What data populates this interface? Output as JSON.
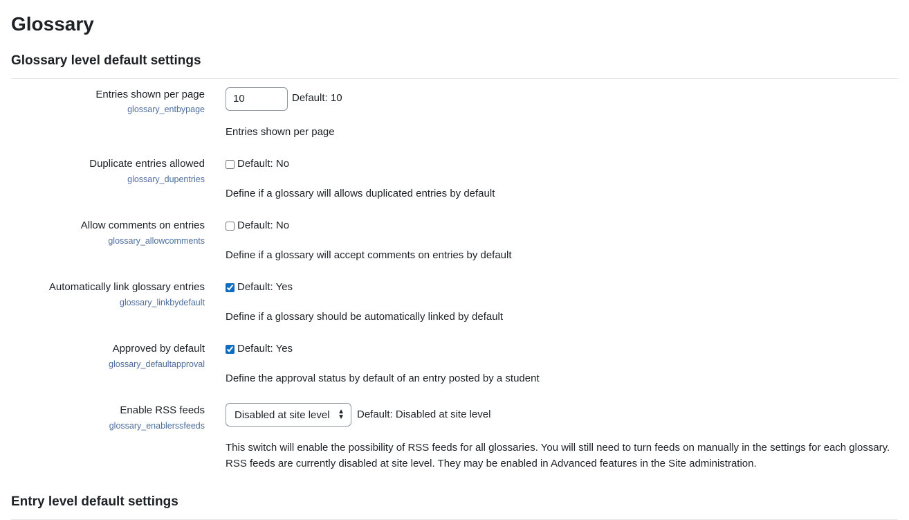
{
  "page": {
    "title": "Glossary",
    "section1_title": "Glossary level default settings",
    "section2_title": "Entry level default settings"
  },
  "settings": {
    "entbypage": {
      "label": "Entries shown per page",
      "key": "glossary_entbypage",
      "value": "10",
      "default_text": "Default: 10",
      "description": "Entries shown per page"
    },
    "dupentries": {
      "label": "Duplicate entries allowed",
      "key": "glossary_dupentries",
      "checked": false,
      "default_text": "Default: No",
      "description": "Define if a glossary will allows duplicated entries by default"
    },
    "allowcomments": {
      "label": "Allow comments on entries",
      "key": "glossary_allowcomments",
      "checked": false,
      "default_text": "Default: No",
      "description": "Define if a glossary will accept comments on entries by default"
    },
    "linkbydefault": {
      "label": "Automatically link glossary entries",
      "key": "glossary_linkbydefault",
      "checked": true,
      "default_text": "Default: Yes",
      "description": "Define if a glossary should be automatically linked by default"
    },
    "defaultapproval": {
      "label": "Approved by default",
      "key": "glossary_defaultapproval",
      "checked": true,
      "default_text": "Default: Yes",
      "description": "Define the approval status by default of an entry posted by a student"
    },
    "enablerssfeeds": {
      "label": "Enable RSS feeds",
      "key": "glossary_enablerssfeeds",
      "selected": "Disabled at site level",
      "default_text": "Default: Disabled at site level",
      "description": "This switch will enable the possibility of RSS feeds for all glossaries. You will still need to turn feeds on manually in the settings for each glossary. RSS feeds are currently disabled at site level. They may be enabled in Advanced features in the Site administration."
    }
  }
}
